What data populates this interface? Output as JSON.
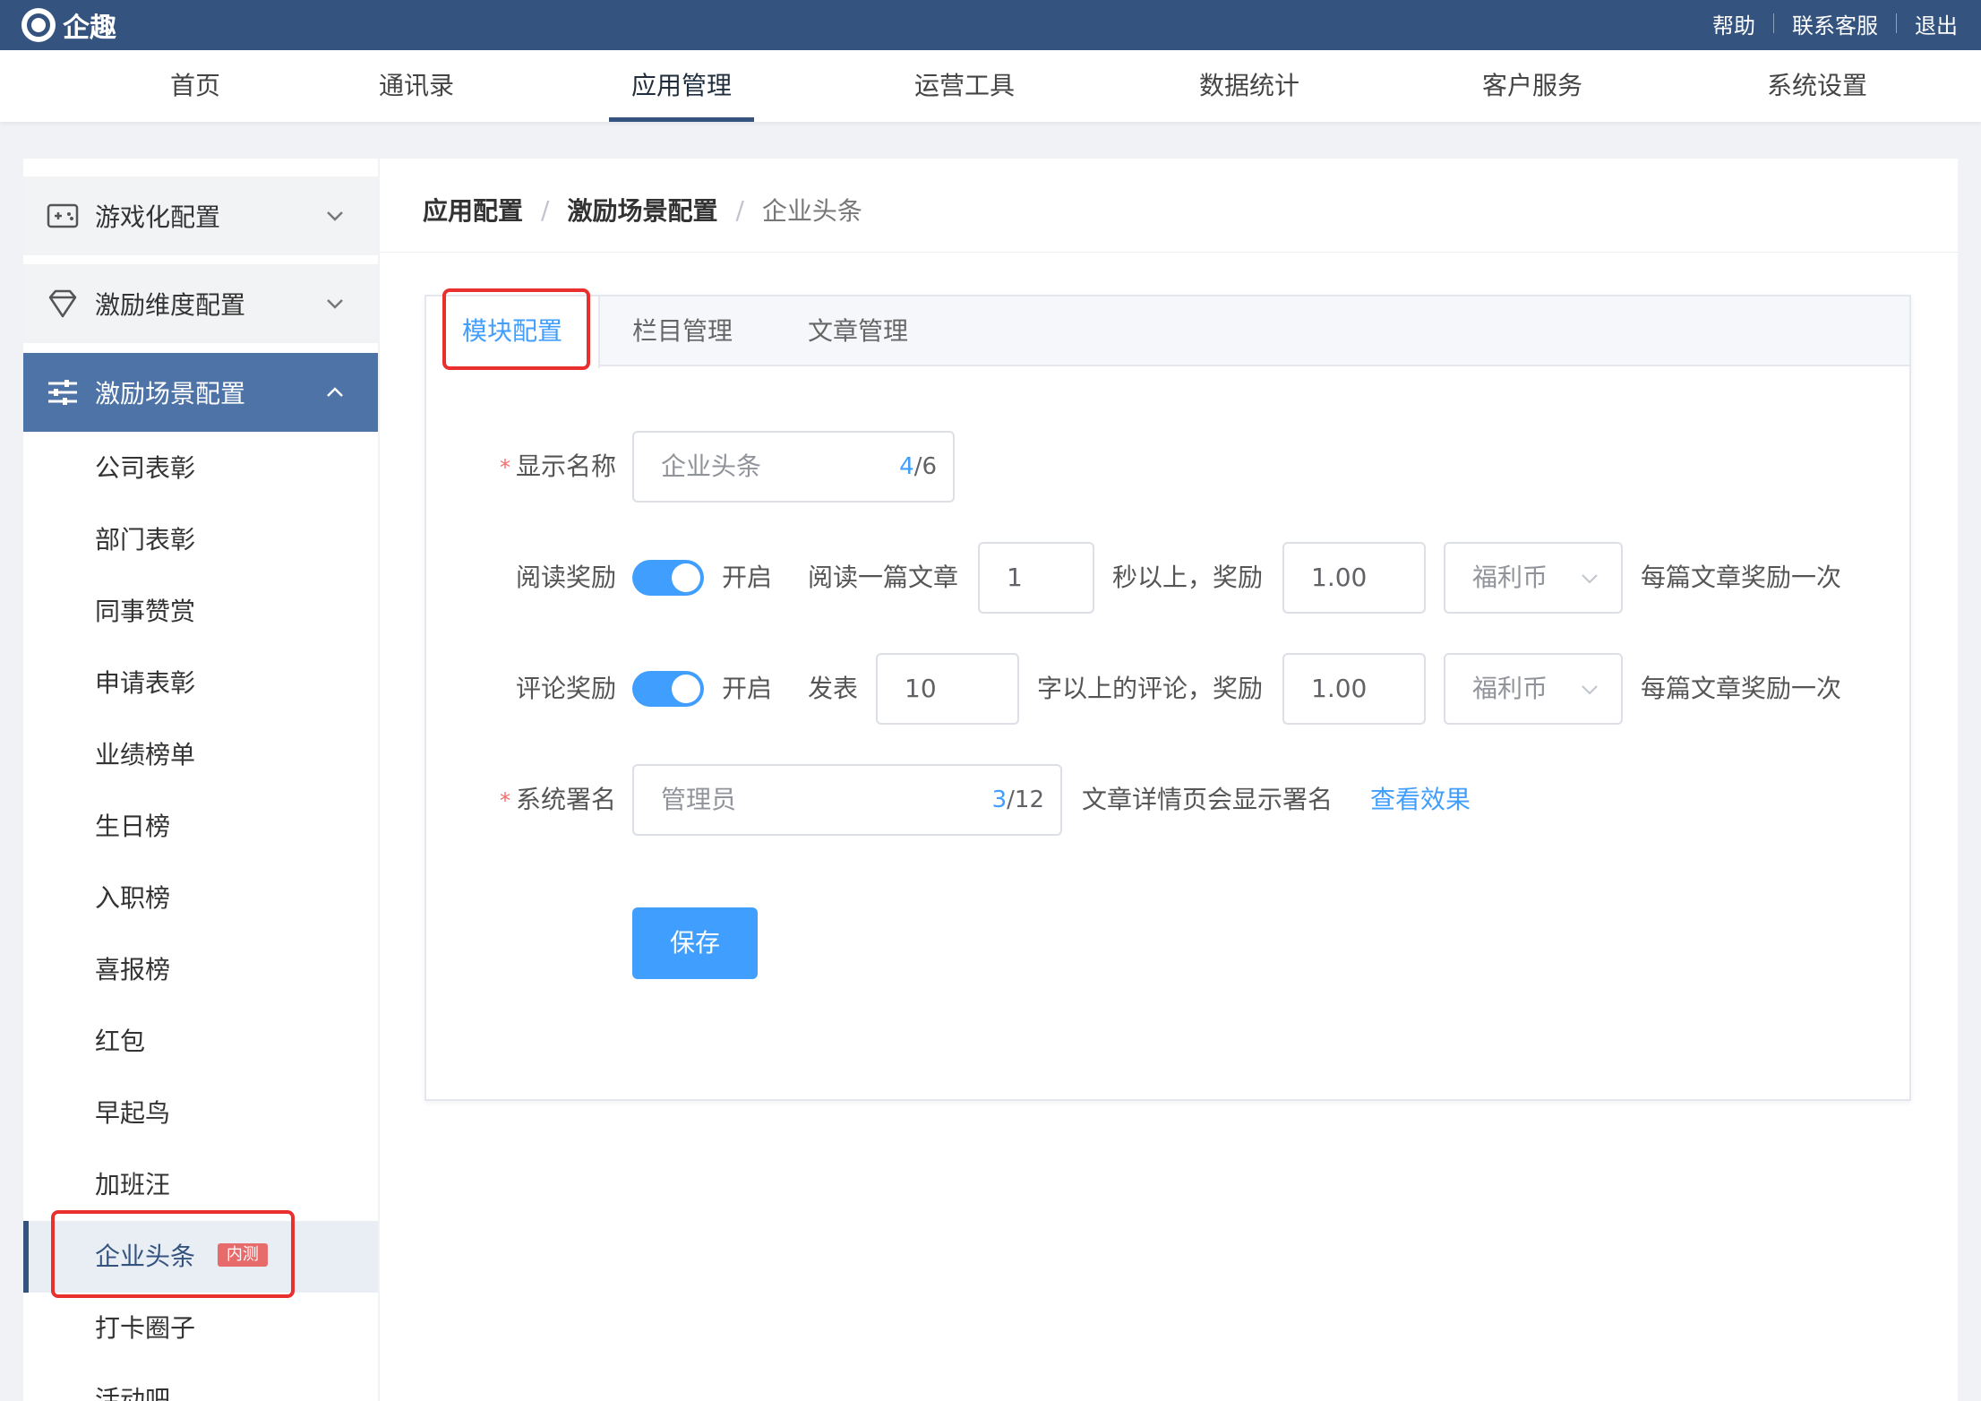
{
  "app": {
    "name": "企趣"
  },
  "top_links": [
    "帮助",
    "联系客服",
    "退出"
  ],
  "main_nav": {
    "items": [
      "首页",
      "通讯录",
      "应用管理",
      "运营工具",
      "数据统计",
      "客户服务",
      "系统设置"
    ],
    "active": "应用管理"
  },
  "sidebar": {
    "groups": [
      {
        "label": "游戏化配置",
        "icon": "gamepad-icon",
        "expanded": false
      },
      {
        "label": "激励维度配置",
        "icon": "diamond-icon",
        "expanded": false
      },
      {
        "label": "激励场景配置",
        "icon": "sliders-icon",
        "expanded": true
      }
    ],
    "items": [
      "公司表彰",
      "部门表彰",
      "同事赞赏",
      "申请表彰",
      "业绩榜单",
      "生日榜",
      "入职榜",
      "喜报榜",
      "红包",
      "早起鸟",
      "加班汪",
      "企业头条",
      "打卡圈子",
      "活动吧"
    ],
    "active_item": "企业头条",
    "active_badge": "内测"
  },
  "breadcrumb": [
    "应用配置",
    "激励场景配置",
    "企业头条"
  ],
  "tabs": [
    "模块配置",
    "栏目管理",
    "文章管理"
  ],
  "active_tab": "模块配置",
  "form": {
    "display_name": {
      "label": "显示名称",
      "value": "企业头条",
      "count_current": "4",
      "count_max": "/6"
    },
    "read_reward": {
      "label": "阅读奖励",
      "switch_on": true,
      "switch_text": "开启",
      "prefix": "阅读一篇文章",
      "seconds": "1",
      "middle": "秒以上，奖励",
      "amount": "1.00",
      "currency": "福利币",
      "suffix": "每篇文章奖励一次"
    },
    "comment_reward": {
      "label": "评论奖励",
      "switch_on": true,
      "switch_text": "开启",
      "prefix": "发表",
      "chars": "10",
      "middle": "字以上的评论，奖励",
      "amount": "1.00",
      "currency": "福利币",
      "suffix": "每篇文章奖励一次"
    },
    "signature": {
      "label": "系统署名",
      "value": "管理员",
      "count_current": "3",
      "count_max": "/12",
      "hint": "文章详情页会显示署名",
      "link": "查看效果"
    },
    "save_label": "保存"
  },
  "colors": {
    "header": "#34537f",
    "sidebar_active": "#4e73a6",
    "primary": "#409eff",
    "highlight_box": "#ea2f2f"
  }
}
